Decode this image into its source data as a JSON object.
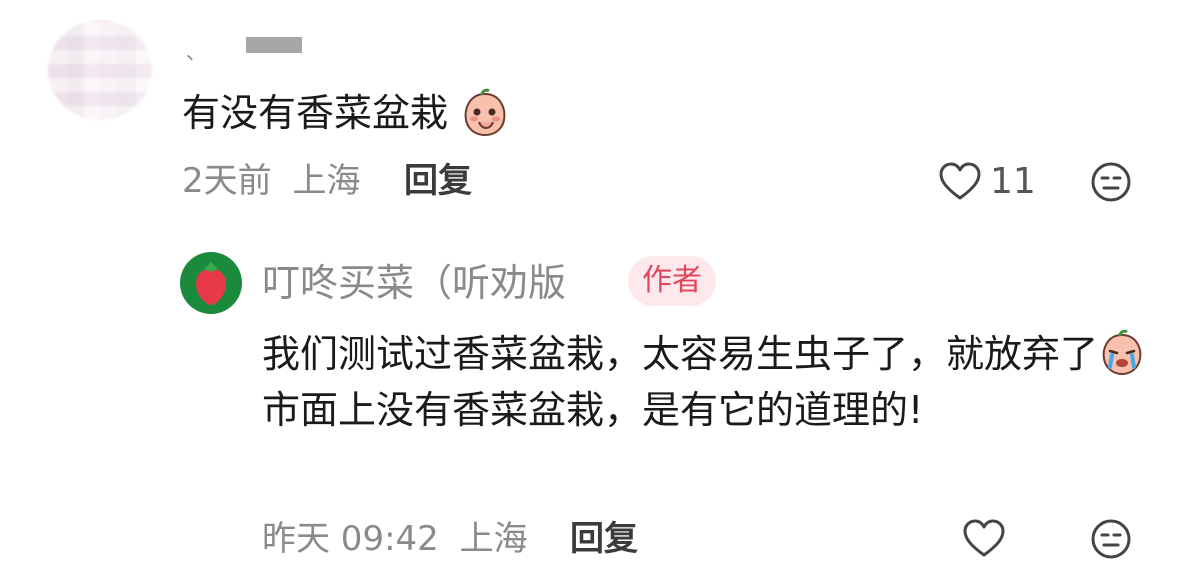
{
  "comment": {
    "user_name": "、",
    "text": "有没有香菜盆栽",
    "time": "2天前",
    "location": "上海",
    "reply_label": "回复",
    "like_count": "11"
  },
  "reply": {
    "user_name": "叮咚买菜（听劝版",
    "badge": "作者",
    "text_part1": "我们测试过香菜盆栽，太容易生虫子了，就放弃了",
    "text_part2": "市面上没有香菜盆栽，是有它的道理的!",
    "time": "昨天 09:42",
    "location": "上海",
    "reply_label": "回复"
  }
}
